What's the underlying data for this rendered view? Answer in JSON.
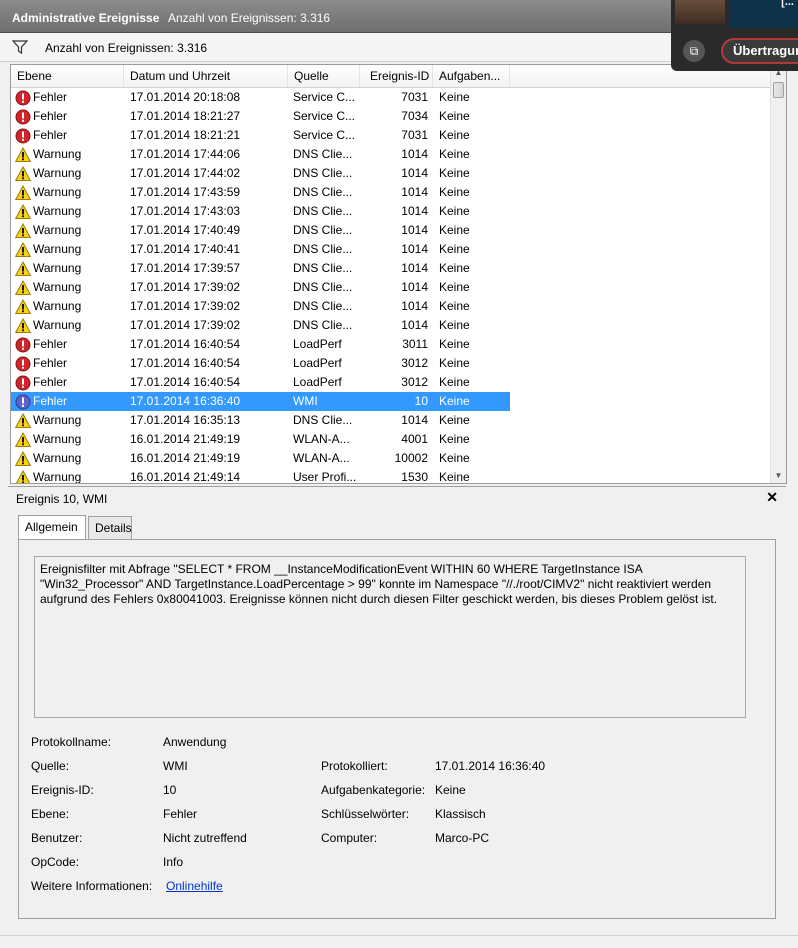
{
  "window": {
    "title": "Administrative Ereignisse",
    "count_label": "Anzahl von Ereignissen: 3.316"
  },
  "filter": {
    "text": "Anzahl von Ereignissen: 3.316"
  },
  "columns": [
    "Ebene",
    "Datum und Uhrzeit",
    "Quelle",
    "Ereignis-ID",
    "Aufgaben..."
  ],
  "events": [
    {
      "level": "Fehler",
      "type": "error",
      "date": "17.01.2014 20:18:08",
      "source": "Service C...",
      "id": "7031",
      "task": "Keine"
    },
    {
      "level": "Fehler",
      "type": "error",
      "date": "17.01.2014 18:21:27",
      "source": "Service C...",
      "id": "7034",
      "task": "Keine"
    },
    {
      "level": "Fehler",
      "type": "error",
      "date": "17.01.2014 18:21:21",
      "source": "Service C...",
      "id": "7031",
      "task": "Keine"
    },
    {
      "level": "Warnung",
      "type": "warning",
      "date": "17.01.2014 17:44:06",
      "source": "DNS Clie...",
      "id": "1014",
      "task": "Keine"
    },
    {
      "level": "Warnung",
      "type": "warning",
      "date": "17.01.2014 17:44:02",
      "source": "DNS Clie...",
      "id": "1014",
      "task": "Keine"
    },
    {
      "level": "Warnung",
      "type": "warning",
      "date": "17.01.2014 17:43:59",
      "source": "DNS Clie...",
      "id": "1014",
      "task": "Keine"
    },
    {
      "level": "Warnung",
      "type": "warning",
      "date": "17.01.2014 17:43:03",
      "source": "DNS Clie...",
      "id": "1014",
      "task": "Keine"
    },
    {
      "level": "Warnung",
      "type": "warning",
      "date": "17.01.2014 17:40:49",
      "source": "DNS Clie...",
      "id": "1014",
      "task": "Keine"
    },
    {
      "level": "Warnung",
      "type": "warning",
      "date": "17.01.2014 17:40:41",
      "source": "DNS Clie...",
      "id": "1014",
      "task": "Keine"
    },
    {
      "level": "Warnung",
      "type": "warning",
      "date": "17.01.2014 17:39:57",
      "source": "DNS Clie...",
      "id": "1014",
      "task": "Keine"
    },
    {
      "level": "Warnung",
      "type": "warning",
      "date": "17.01.2014 17:39:02",
      "source": "DNS Clie...",
      "id": "1014",
      "task": "Keine"
    },
    {
      "level": "Warnung",
      "type": "warning",
      "date": "17.01.2014 17:39:02",
      "source": "DNS Clie...",
      "id": "1014",
      "task": "Keine"
    },
    {
      "level": "Warnung",
      "type": "warning",
      "date": "17.01.2014 17:39:02",
      "source": "DNS Clie...",
      "id": "1014",
      "task": "Keine"
    },
    {
      "level": "Fehler",
      "type": "error",
      "date": "17.01.2014 16:40:54",
      "source": "LoadPerf",
      "id": "3011",
      "task": "Keine"
    },
    {
      "level": "Fehler",
      "type": "error",
      "date": "17.01.2014 16:40:54",
      "source": "LoadPerf",
      "id": "3012",
      "task": "Keine"
    },
    {
      "level": "Fehler",
      "type": "error",
      "date": "17.01.2014 16:40:54",
      "source": "LoadPerf",
      "id": "3012",
      "task": "Keine"
    },
    {
      "level": "Fehler",
      "type": "error",
      "date": "17.01.2014 16:36:40",
      "source": "WMI",
      "id": "10",
      "task": "Keine",
      "selected": true
    },
    {
      "level": "Warnung",
      "type": "warning",
      "date": "17.01.2014 16:35:13",
      "source": "DNS Clie...",
      "id": "1014",
      "task": "Keine"
    },
    {
      "level": "Warnung",
      "type": "warning",
      "date": "16.01.2014 21:49:19",
      "source": "WLAN-A...",
      "id": "4001",
      "task": "Keine"
    },
    {
      "level": "Warnung",
      "type": "warning",
      "date": "16.01.2014 21:49:19",
      "source": "WLAN-A...",
      "id": "10002",
      "task": "Keine"
    },
    {
      "level": "Warnung",
      "type": "warning",
      "date": "16.01.2014 21:49:14",
      "source": "User Profi...",
      "id": "1530",
      "task": "Keine"
    }
  ],
  "detail": {
    "title": "Ereignis 10, WMI",
    "tabs": [
      "Allgemein",
      "Details"
    ],
    "message": "Ereignisfilter mit Abfrage \"SELECT * FROM __InstanceModificationEvent WITHIN 60 WHERE TargetInstance ISA \"Win32_Processor\" AND TargetInstance.LoadPercentage > 99\" konnte im Namespace \"//./root/CIMV2\" nicht reaktiviert werden aufgrund des Fehlers 0x80041003. Ereignisse können nicht durch diesen Filter geschickt werden, bis dieses Problem gelöst ist.",
    "props": {
      "protokollname_label": "Protokollname:",
      "protokollname": "Anwendung",
      "quelle_label": "Quelle:",
      "quelle": "WMI",
      "protokolliert_label": "Protokolliert:",
      "protokolliert": "17.01.2014 16:36:40",
      "ereignisid_label": "Ereignis-ID:",
      "ereignisid": "10",
      "aufgabenkategorie_label": "Aufgabenkategorie:",
      "aufgabenkategorie": "Keine",
      "ebene_label": "Ebene:",
      "ebene": "Fehler",
      "schluesselwoerter_label": "Schlüsselwörter:",
      "schluesselwoerter": "Klassisch",
      "benutzer_label": "Benutzer:",
      "benutzer": "Nicht zutreffend",
      "computer_label": "Computer:",
      "computer": "Marco-PC",
      "opcode_label": "OpCode:",
      "opcode": "Info",
      "weitere_label": "Weitere Informationen:",
      "weitere_link": "Onlinehilfe"
    }
  },
  "overlay": {
    "video_text": "[...",
    "button_label": "Übertragun"
  }
}
